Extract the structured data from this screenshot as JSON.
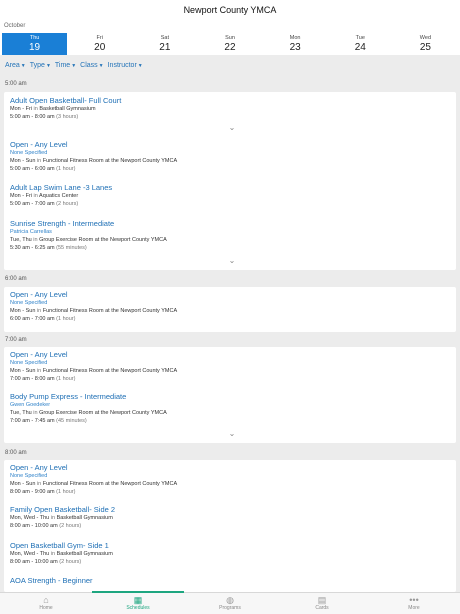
{
  "header": {
    "title": "Newport County YMCA"
  },
  "calendar": {
    "month": "October",
    "days": [
      {
        "name": "Thu",
        "num": "19"
      },
      {
        "name": "Fri",
        "num": "20"
      },
      {
        "name": "Sat",
        "num": "21"
      },
      {
        "name": "Sun",
        "num": "22"
      },
      {
        "name": "Mon",
        "num": "23"
      },
      {
        "name": "Tue",
        "num": "24"
      },
      {
        "name": "Wed",
        "num": "25"
      }
    ]
  },
  "filters": [
    "Area",
    "Type",
    "Time",
    "Class",
    "Instructor"
  ],
  "groups": [
    {
      "time": "5:00 am",
      "items": [
        {
          "title": "Adult Open Basketball- Full Court",
          "instructor": "",
          "days": "Mon - Fri",
          "in": "in",
          "room": "Basketball Gymnasium",
          "hours": "5:00 am - 8:00 am",
          "duration": "(3 hours)"
        },
        {
          "title": "Open - Any Level",
          "instructor": "None Specified",
          "days": "Mon - Sun",
          "in": "in",
          "room": "Functional Fitness Room at the Newport County YMCA",
          "hours": "5:00 am - 6:00 am",
          "duration": "(1 hour)"
        },
        {
          "title": "Adult Lap Swim Lane -3 Lanes",
          "instructor": "",
          "days": "Mon - Fri",
          "in": "in",
          "room": "Aquatics Center",
          "hours": "5:00 am - 7:00 am",
          "duration": "(2 hours)"
        },
        {
          "title": "Sunrise Strength - Intermediate",
          "instructor": "Patricia Carrellas",
          "days": "Tue, Thu",
          "in": "in",
          "room": "Group Exercise Room at the Newport County YMCA",
          "hours": "5:30 am - 6:25 am",
          "duration": "(55 minutes)"
        }
      ]
    },
    {
      "time": "6:00 am",
      "items": [
        {
          "title": "Open - Any Level",
          "instructor": "None Specified",
          "days": "Mon - Sun",
          "in": "in",
          "room": "Functional Fitness Room at the Newport County YMCA",
          "hours": "6:00 am - 7:00 am",
          "duration": "(1 hour)"
        }
      ]
    },
    {
      "time": "7:00 am",
      "items": [
        {
          "title": "Open - Any Level",
          "instructor": "None Specified",
          "days": "Mon - Sun",
          "in": "in",
          "room": "Functional Fitness Room at the Newport County YMCA",
          "hours": "7:00 am - 8:00 am",
          "duration": "(1 hour)"
        },
        {
          "title": "Body Pump Express - Intermediate",
          "instructor": "Gwen Goedeker",
          "days": "Tue, Thu",
          "in": "in",
          "room": "Group Exercise Room at the Newport County YMCA",
          "hours": "7:00 am - 7:45 am",
          "duration": "(45 minutes)"
        }
      ]
    },
    {
      "time": "8:00 am",
      "items": [
        {
          "title": "Open - Any Level",
          "instructor": "None Specified",
          "days": "Mon - Sun",
          "in": "in",
          "room": "Functional Fitness Room at the Newport County YMCA",
          "hours": "8:00 am - 9:00 am",
          "duration": "(1 hour)"
        },
        {
          "title": "Family Open Basketball- Side 2",
          "instructor": "",
          "days": "Mon, Wed - Thu",
          "in": "in",
          "room": "Basketball Gymnasium",
          "hours": "8:00 am - 10:00 am",
          "duration": "(2 hours)"
        },
        {
          "title": "Open Basketball Gym- Side 1",
          "instructor": "",
          "days": "Mon, Wed - Thu",
          "in": "in",
          "room": "Basketball Gymnasium",
          "hours": "8:00 am - 10:00 am",
          "duration": "(2 hours)"
        },
        {
          "title": "AOA Strength - Beginner",
          "instructor": "",
          "days": "",
          "in": "",
          "room": "",
          "hours": "",
          "duration": ""
        }
      ]
    }
  ],
  "tabbar": [
    {
      "label": "Home",
      "icon": "home-icon"
    },
    {
      "label": "Schedules",
      "icon": "calendar-icon"
    },
    {
      "label": "Programs",
      "icon": "basketball-icon"
    },
    {
      "label": "Cards",
      "icon": "barcode-icon"
    },
    {
      "label": "More",
      "icon": "more-dots-icon"
    }
  ]
}
